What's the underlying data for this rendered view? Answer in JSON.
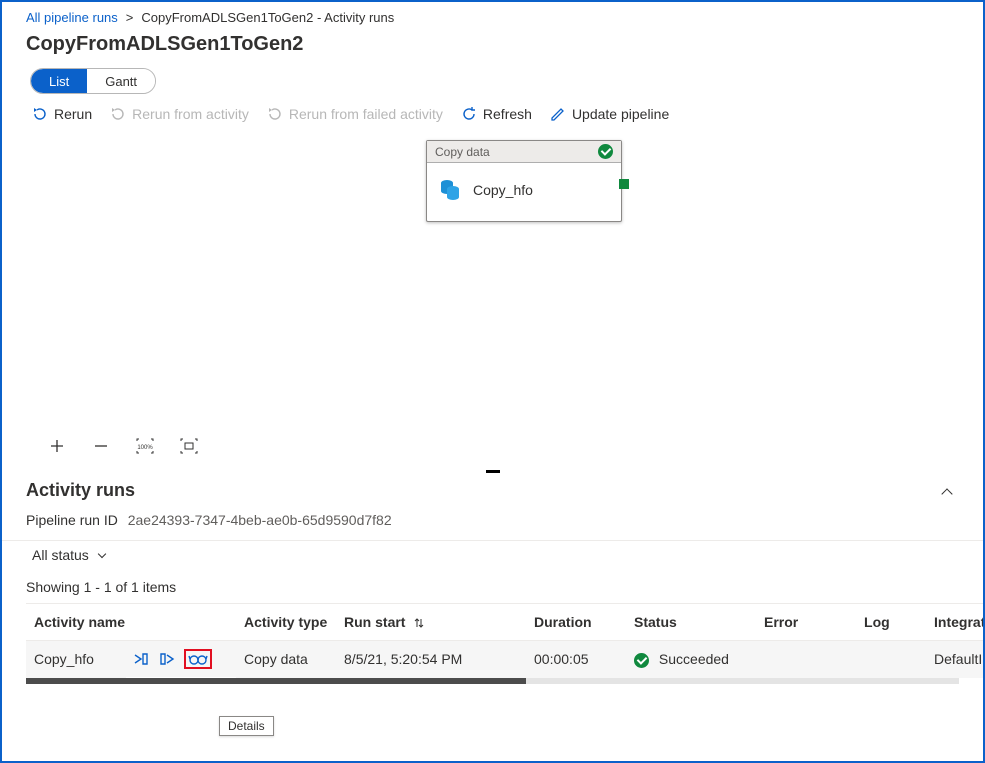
{
  "breadcrumb": {
    "root": "All pipeline runs",
    "sep": ">",
    "current": "CopyFromADLSGen1ToGen2 - Activity runs"
  },
  "page_title": "CopyFromADLSGen1ToGen2",
  "view_tabs": {
    "list": "List",
    "gantt": "Gantt"
  },
  "toolbar": {
    "rerun": "Rerun",
    "rerun_from_activity": "Rerun from activity",
    "rerun_from_failed": "Rerun from failed activity",
    "refresh": "Refresh",
    "update_pipeline": "Update pipeline"
  },
  "activity_card": {
    "type_label": "Copy data",
    "name": "Copy_hfo"
  },
  "zoom": {
    "percent": "100%"
  },
  "activity_runs": {
    "header": "Activity runs",
    "pipeline_run_id_label": "Pipeline run ID",
    "pipeline_run_id_value": "2ae24393-7347-4beb-ae0b-65d9590d7f82",
    "filter": "All status",
    "showing": "Showing 1 - 1 of 1 items",
    "columns": {
      "activity_name": "Activity name",
      "activity_type": "Activity type",
      "run_start": "Run start",
      "duration": "Duration",
      "status": "Status",
      "error": "Error",
      "log": "Log",
      "integration_runtime": "Integration runtime"
    },
    "rows": [
      {
        "name": "Copy_hfo",
        "type": "Copy data",
        "start": "8/5/21, 5:20:54 PM",
        "duration": "00:00:05",
        "status": "Succeeded",
        "error": "",
        "log": "",
        "integration": "DefaultInteg"
      }
    ]
  },
  "tooltip": {
    "details": "Details"
  }
}
